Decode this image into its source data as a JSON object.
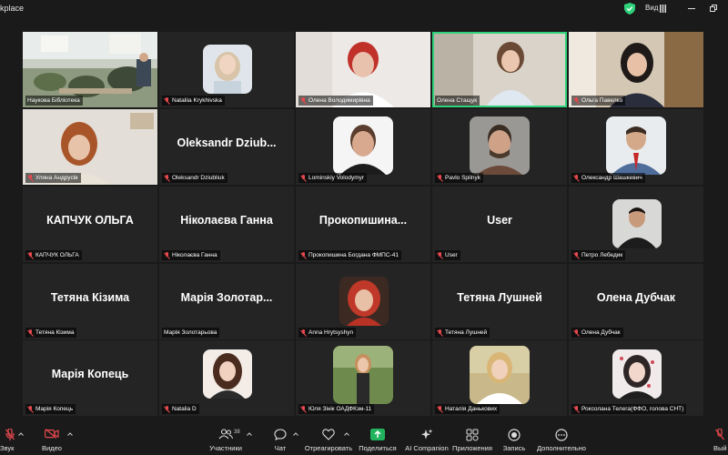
{
  "window": {
    "title": "kplace",
    "view_label": "Вид",
    "accent": "#2fd17a"
  },
  "participants": [
    {
      "name": "Наукова Бібліотека",
      "display": "photo",
      "muted": false
    },
    {
      "name": "Nataliia Krykhivska",
      "display": "avatar",
      "muted": true
    },
    {
      "name": "Олена Володимирівна",
      "display": "photo",
      "muted": true
    },
    {
      "name": "Олена Стащук",
      "display": "photo",
      "muted": false,
      "active": true
    },
    {
      "name": "Ольга Павелко",
      "display": "photo",
      "muted": true
    },
    {
      "name": "Уляна Андрусів",
      "display": "photo",
      "muted": true
    },
    {
      "name": "Oleksandr Dziubliuk",
      "display": "text",
      "big_name": "Oleksandr  Dziub...",
      "muted": true
    },
    {
      "name": "Lominskiy Volodymyr",
      "display": "avatar",
      "muted": true
    },
    {
      "name": "Pavlo Spilnyk",
      "display": "avatar",
      "muted": true
    },
    {
      "name": "Олександр Шашкевич",
      "display": "avatar",
      "muted": true
    },
    {
      "name": "КАПЧУК ОЛЬГА",
      "display": "text",
      "big_name": "КАПЧУК ОЛЬГА",
      "muted": true
    },
    {
      "name": "Ніколаєва Ганна",
      "display": "text",
      "big_name": "Ніколаєва Ганна",
      "muted": true
    },
    {
      "name": "Прокопишина Богдана ФМПС-41",
      "display": "text",
      "big_name": "Прокопишина...",
      "muted": true
    },
    {
      "name": "User",
      "display": "text",
      "big_name": "User",
      "muted": true
    },
    {
      "name": "Петро Лебедик",
      "display": "avatar",
      "muted": true
    },
    {
      "name": "Тетяна Кізима",
      "display": "text",
      "big_name": "Тетяна Кізима",
      "muted": true
    },
    {
      "name": "Марія Золотарьова",
      "display": "text",
      "big_name": "Марія Золотар...",
      "muted": false
    },
    {
      "name": "Anna Hrytsyshyn",
      "display": "avatar",
      "muted": true
    },
    {
      "name": "Тетяна Лушней",
      "display": "text",
      "big_name": "Тетяна Лушней",
      "muted": true
    },
    {
      "name": "Олена Дубчак",
      "display": "text",
      "big_name": "Олена Дубчак",
      "muted": true
    },
    {
      "name": "Марія Копець",
      "display": "text",
      "big_name": "Марія Копець",
      "muted": true
    },
    {
      "name": "Natalia D",
      "display": "avatar",
      "muted": true
    },
    {
      "name": "Юля Зінік ОАДФКзм-11",
      "display": "avatar",
      "muted": true
    },
    {
      "name": "Наталія Данькових",
      "display": "avatar",
      "muted": true
    },
    {
      "name": "Роксолана Телега(ФФО, голова СНТ)",
      "display": "avatar",
      "muted": true
    }
  ],
  "toolbar": {
    "audio_label": "Звук",
    "video_label": "Видео",
    "participants_label": "Участники",
    "participants_count": "38",
    "chat_label": "Чат",
    "react_label": "Отреагировать",
    "share_label": "Поделиться",
    "companion_label": "AI Companion",
    "apps_label": "Приложения",
    "record_label": "Запись",
    "more_label": "Дополнительно",
    "leave_label": "Вый"
  }
}
